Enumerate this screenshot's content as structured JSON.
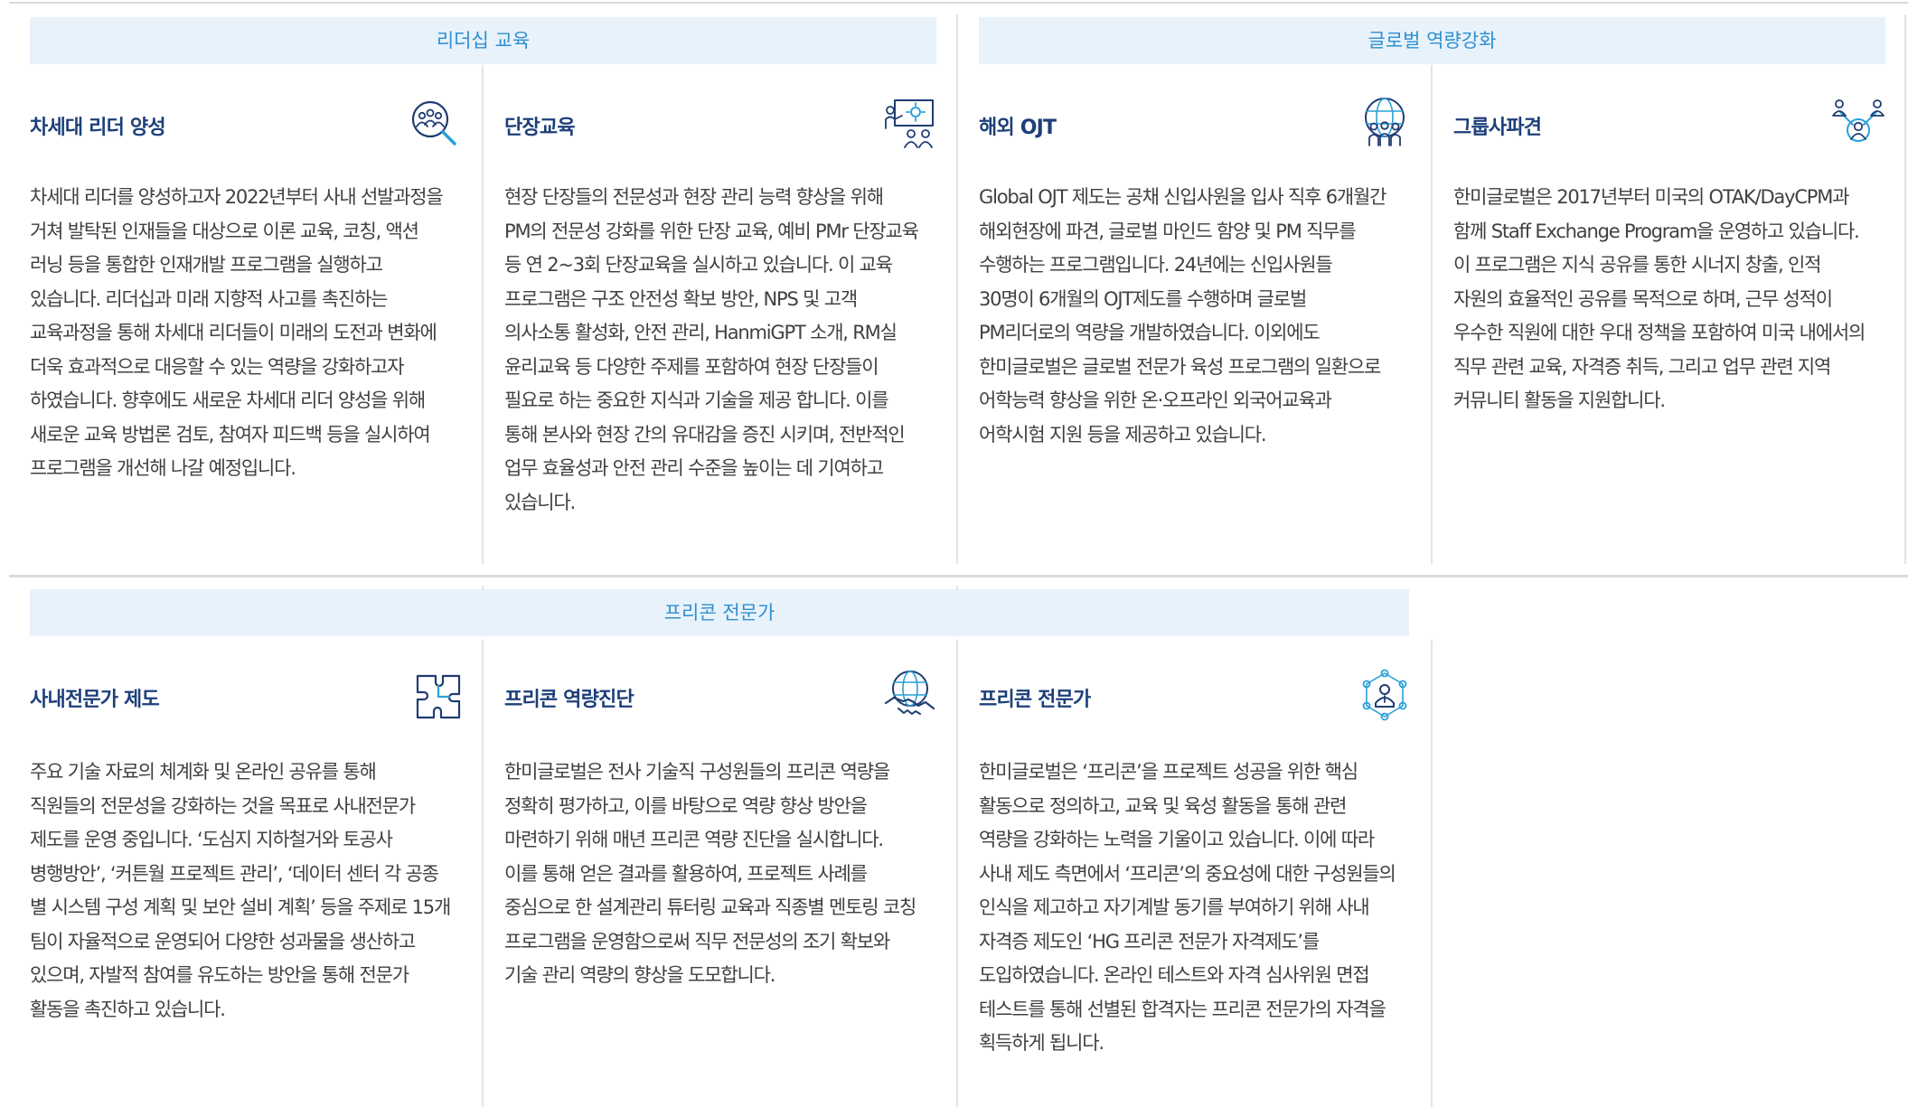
{
  "sections": {
    "leadership": {
      "label": "리더십 교육"
    },
    "global": {
      "label": "글로벌 역량강화"
    },
    "precon": {
      "label": "프리콘 전문가"
    }
  },
  "cards": {
    "next_gen_leader": {
      "icon": "magnifier-people-icon",
      "title": "차세대 리더 양성",
      "body": "차세대 리더를 양성하고자 2022년부터 사내 선발과정을\n거쳐 발탁된 인재들을 대상으로 이론 교육, 코칭, 액션\n러닝 등을 통합한 인재개발 프로그램을 실행하고\n있습니다. 리더십과 미래 지향적 사고를 촉진하는\n교육과정을 통해 차세대 리더들이 미래의 도전과 변화에\n더욱 효과적으로 대응할 수 있는 역량을 강화하고자\n하였습니다. 향후에도 새로운 차세대 리더 양성을 위해\n새로운 교육 방법론 검토, 참여자 피드백 등을 실시하여\n프로그램을 개선해 나갈 예정입니다."
    },
    "site_manager": {
      "icon": "presentation-board-icon",
      "title": "단장교육",
      "body": "현장 단장들의 전문성과 현장 관리 능력 향상을 위해\nPM의 전문성 강화를 위한 단장 교육, 예비 PMr 단장교육\n등 연 2~3회 단장교육을 실시하고 있습니다. 이 교육\n프로그램은 구조 안전성 확보 방안, NPS 및 고객\n의사소통 활성화, 안전 관리, HanmiGPT 소개, RM실\n윤리교육 등 다양한 주제를 포함하여 현장 단장들이\n필요로 하는 중요한 지식과 기술을 제공 합니다. 이를\n통해 본사와 현장 간의 유대감을 증진 시키며, 전반적인\n업무 효율성과 안전 관리 수준을 높이는 데 기여하고\n있습니다."
    },
    "overseas_ojt": {
      "icon": "globe-people-icon",
      "title": "해외 OJT",
      "body": "Global OJT 제도는 공채 신입사원을 입사 직후 6개월간\n해외현장에 파견, 글로벌 마인드 함양 및 PM 직무를\n수행하는 프로그램입니다. 24년에는 신입사원들\n30명이 6개월의 OJT제도를 수행하며 글로벌\nPM리더로의 역량을 개발하였습니다. 이외에도\n한미글로벌은 글로벌 전문가 육성 프로그램의 일환으로\n어학능력 향상을 위한 온·오프라인 외국어교육과\n어학시험 지원 등을 제공하고 있습니다."
    },
    "group_dispatch": {
      "icon": "team-network-icon",
      "title": "그룹사파견",
      "body": "한미글로벌은 2017년부터 미국의 OTAK/DayCPM과\n함께 Staff Exchange Program을 운영하고 있습니다.\n이 프로그램은 지식 공유를 통한 시너지 창출, 인적\n자원의 효율적인 공유를 목적으로 하며, 근무 성적이\n우수한 직원에 대한 우대 정책을 포함하여 미국 내에서의\n직무 관련 교육, 자격증 취득, 그리고 업무 관련 지역\n커뮤니티 활동을 지원합니다."
    },
    "in_house_expert": {
      "icon": "puzzle-icon",
      "title": "사내전문가 제도",
      "body": "주요 기술 자료의 체계화 및 온라인 공유를 통해\n직원들의 전문성을 강화하는 것을 목표로 사내전문가\n제도를 운영 중입니다. ‘도심지 지하철거와 토공사\n병행방안’, ‘커튼월 프로젝트 관리’, ‘데이터 센터 각 공종\n별 시스템 구성 계획 및 보안 설비 계획’ 등을 주제로 15개\n팀이 자율적으로 운영되어 다양한 성과물을 생산하고\n있으며, 자발적 참여를 유도하는 방안을 통해 전문가\n활동을 촉진하고 있습니다."
    },
    "precon_diagnosis": {
      "icon": "globe-handshake-icon",
      "title": "프리콘 역량진단",
      "body": "한미글로벌은 전사 기술직 구성원들의 프리콘 역량을\n정확히 평가하고, 이를 바탕으로 역량 향상 방안을\n마련하기 위해 매년 프리콘 역량 진단을 실시합니다.\n이를 통해 얻은 결과를 활용하여, 프로젝트 사례를\n중심으로 한 설계관리 튜터링 교육과 직종별 멘토링 코칭\n프로그램을 운영함으로써 직무 전문성의 조기 확보와\n기술 관리 역량의 향상을 도모합니다."
    },
    "precon_expert": {
      "icon": "expert-network-icon",
      "title": "프리콘 전문가",
      "body": "한미글로벌은 ‘프리콘’을 프로젝트 성공을 위한 핵심\n활동으로 정의하고, 교육 및 육성 활동을 통해 관련\n역량을 강화하는 노력을 기울이고 있습니다. 이에 따라\n사내 제도 측면에서 ‘프리콘’의 중요성에 대한 구성원들의\n인식을 제고하고 자기계발 동기를 부여하기 위해 사내\n자격증 제도인 ‘HG 프리콘 전문가 자격제도’를\n도입하였습니다. 온라인 테스트와 자격 심사위원 면접\n테스트를 통해 선별된 합격자는 프리콘 전문가의 자격을\n획득하게 됩니다."
    }
  },
  "colors": {
    "banner_bg": "#e7f2fb",
    "banner_text": "#2f8fcf",
    "title": "#1d3f7a",
    "icon_navy": "#1f3d73",
    "icon_cyan": "#2aa0d8",
    "divider": "#dadada"
  }
}
